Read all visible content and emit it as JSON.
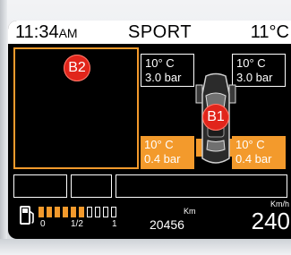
{
  "status": {
    "time": "11:34",
    "ampm": "AM",
    "mode": "SPORT",
    "outside_temp": "11°C"
  },
  "panels": {
    "left_badge": "B2",
    "tyre_badge": "B1"
  },
  "tyres": {
    "front_left": {
      "temp": "10° C",
      "pressure": "3.0 bar",
      "status": "ok"
    },
    "front_right": {
      "temp": "10° C",
      "pressure": "3.0 bar",
      "status": "ok"
    },
    "rear_left": {
      "temp": "10° C",
      "pressure": "0.4 bar",
      "status": "low"
    },
    "rear_right": {
      "temp": "10° C",
      "pressure": "0.4 bar",
      "status": "low"
    }
  },
  "fuel": {
    "level_fraction": 0.6,
    "segments_total": 10,
    "labels": [
      "0",
      "1/2",
      "1"
    ]
  },
  "odometer": {
    "unit": "Km",
    "value": "20456"
  },
  "speed": {
    "unit": "Km/h",
    "value": "240"
  },
  "colors": {
    "accent": "#f39a2c",
    "badge": "#e1251b",
    "screen_bg": "#000000",
    "status_bg": "#ffffff"
  },
  "icons": {
    "fuel": "fuel-pump-icon",
    "car": "car-top-view-icon"
  }
}
